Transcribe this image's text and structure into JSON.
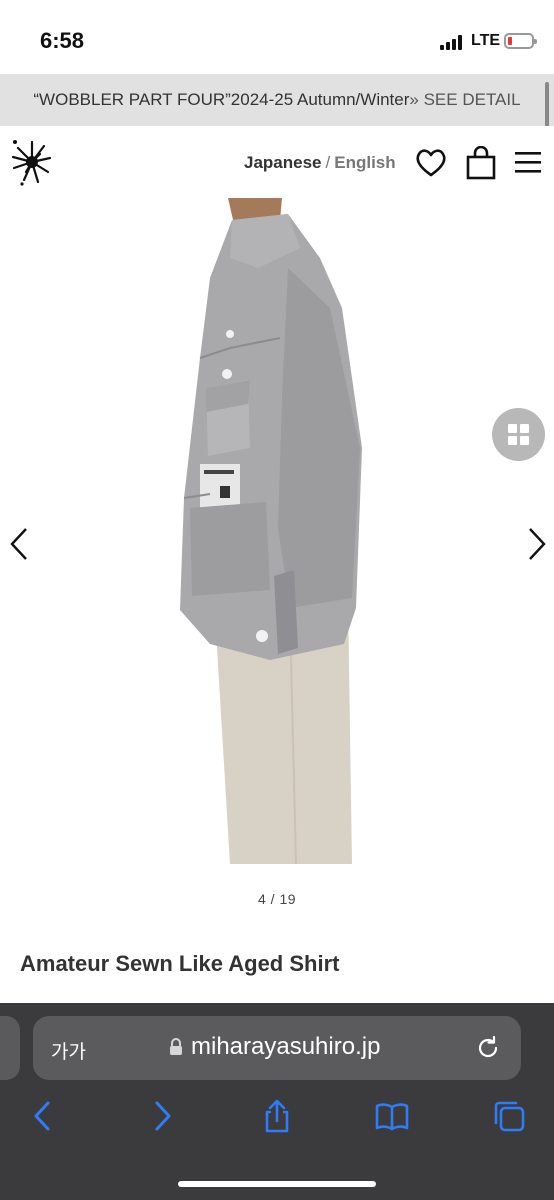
{
  "status_bar": {
    "time": "6:58",
    "network": "LTE",
    "battery_color": "#e53935"
  },
  "banner": {
    "text": "“WOBBLER PART FOUR”2024-25 Autumn/Winter",
    "link": "» SEE DETAIL",
    "background": "#e1e1e1"
  },
  "header": {
    "lang_japanese": "Japanese",
    "lang_separator": "/",
    "lang_english": "English",
    "icons": [
      "splatter-logo-icon",
      "heart-icon",
      "shopping-bag-icon",
      "hamburger-menu-icon"
    ]
  },
  "gallery": {
    "counter": "4 / 19",
    "current_index": 4,
    "total": 19,
    "icons": [
      "grid-view-icon",
      "chevron-left-icon",
      "chevron-right-icon"
    ]
  },
  "product": {
    "title": "Amateur Sewn Like Aged Shirt"
  },
  "browser": {
    "aa_label": "가가",
    "url": "miharayasuhiro.jp",
    "accent": "#2f7cf6",
    "toolbar_icons": [
      "back-arrow-icon",
      "forward-arrow-icon",
      "share-icon",
      "bookmarks-icon",
      "tabs-icon"
    ]
  }
}
